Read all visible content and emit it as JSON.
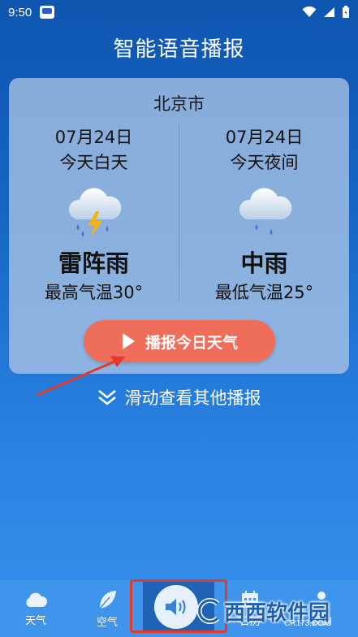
{
  "status_bar": {
    "time": "9:50"
  },
  "header": {
    "title": "智能语音播报"
  },
  "card": {
    "city": "北京市",
    "day": {
      "date": "07月24日",
      "period": "今天白天",
      "icon": "thunderstorm-icon",
      "condition": "雷阵雨",
      "temp_label": "最高气温30°"
    },
    "night": {
      "date": "07月24日",
      "period": "今天夜间",
      "icon": "rain-icon",
      "condition": "中雨",
      "temp_label": "最低气温25°"
    },
    "play_label": "播报今日天气"
  },
  "swipe_hint": "滑动查看其他播报",
  "bottom_nav": {
    "items": [
      {
        "label": "天气",
        "icon": "cloud-icon"
      },
      {
        "label": "空气",
        "icon": "leaf-icon"
      },
      {
        "label": "",
        "icon": "speaker-icon"
      },
      {
        "label": "日历",
        "icon": "calendar-icon"
      },
      {
        "label": "我的",
        "icon": "person-icon"
      }
    ]
  },
  "watermark": {
    "text": "西西软件园",
    "url": "CR173.COM"
  },
  "colors": {
    "play_button": "#ef6e5a",
    "annotation": "#e23b2e",
    "nav_bg": "#3f94ec"
  }
}
